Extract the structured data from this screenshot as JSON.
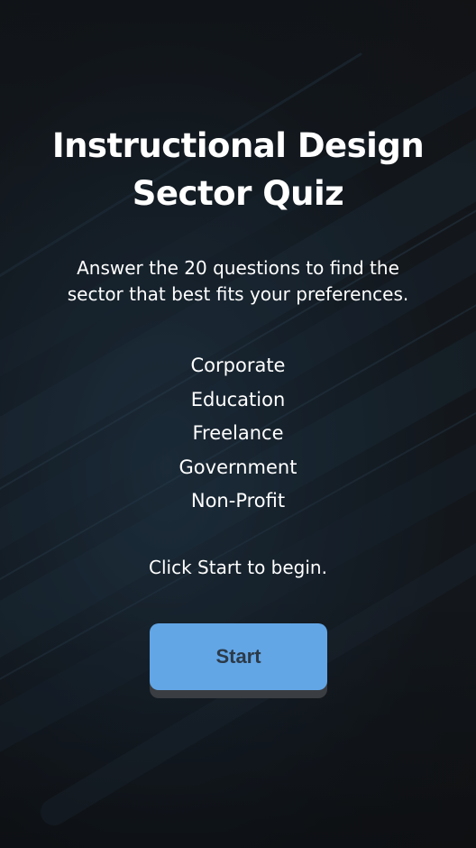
{
  "quiz": {
    "title_lines": [
      "Instructional Design",
      "Sector Quiz"
    ],
    "subtitle_lines": [
      "Answer the 20 questions to find the",
      "sector that best fits your preferences."
    ],
    "sectors": [
      "Corporate",
      "Education",
      "Freelance",
      "Government",
      "Non-Profit"
    ],
    "instruction": "Click Start to begin.",
    "start_label": "Start"
  },
  "colors": {
    "button": "#62a6e6",
    "button_text": "#2c3a48",
    "text": "#ffffff",
    "background": "#15191d"
  }
}
